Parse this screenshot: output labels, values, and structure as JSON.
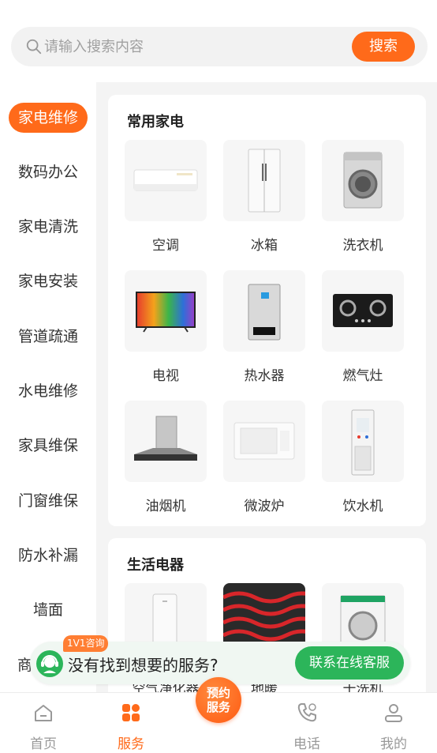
{
  "search": {
    "placeholder": "请输入搜索内容",
    "button_label": "搜索"
  },
  "sidebar": {
    "items": [
      {
        "label": "家电维修",
        "active": true
      },
      {
        "label": "数码办公"
      },
      {
        "label": "家电清洗"
      },
      {
        "label": "家电安装"
      },
      {
        "label": "管道疏通"
      },
      {
        "label": "水电维修"
      },
      {
        "label": "家具维保"
      },
      {
        "label": "门窗维保"
      },
      {
        "label": "防水补漏"
      },
      {
        "label": "墙面"
      },
      {
        "label": "商"
      }
    ]
  },
  "sections": [
    {
      "title": "常用家电",
      "items": [
        {
          "label": "空调",
          "icon": "air-conditioner-icon"
        },
        {
          "label": "冰箱",
          "icon": "refrigerator-icon"
        },
        {
          "label": "洗衣机",
          "icon": "washing-machine-icon"
        },
        {
          "label": "电视",
          "icon": "tv-icon"
        },
        {
          "label": "热水器",
          "icon": "water-heater-icon"
        },
        {
          "label": "燃气灶",
          "icon": "gas-stove-icon"
        },
        {
          "label": "油烟机",
          "icon": "range-hood-icon"
        },
        {
          "label": "微波炉",
          "icon": "microwave-icon"
        },
        {
          "label": "饮水机",
          "icon": "water-dispenser-icon"
        }
      ]
    },
    {
      "title": "生活电器",
      "items": [
        {
          "label": "空气净化器",
          "icon": "air-purifier-icon"
        },
        {
          "label": "地暖",
          "icon": "floor-heating-icon"
        },
        {
          "label": "干洗机",
          "icon": "dry-cleaner-icon"
        }
      ]
    }
  ],
  "consult": {
    "badge": "1V1咨询",
    "text": "没有找到想要的服务?",
    "button_label": "联系在线客服"
  },
  "center_button": {
    "line1": "预约",
    "line2": "服务"
  },
  "tabbar": {
    "items": [
      {
        "label": "首页",
        "icon": "home-icon"
      },
      {
        "label": "服务",
        "icon": "grid-icon",
        "active": true
      },
      {
        "label": "电话",
        "icon": "phone-icon"
      },
      {
        "label": "我的",
        "icon": "user-icon"
      }
    ]
  },
  "colors": {
    "accent": "#ff6a1a",
    "green": "#2cb55a"
  }
}
